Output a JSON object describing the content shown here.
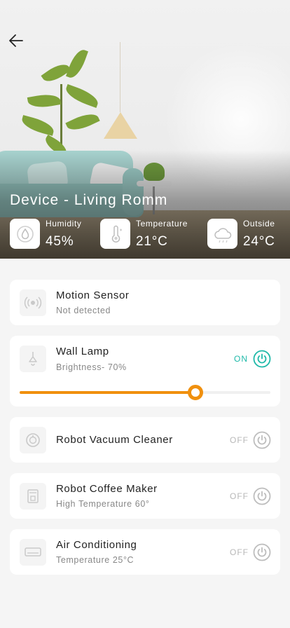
{
  "header": {
    "room_title": "Device - Living Romm"
  },
  "stats": [
    {
      "label": "Humidity",
      "value": "45%",
      "icon": "humidity-icon"
    },
    {
      "label": "Temperature",
      "value": "21°C",
      "icon": "thermometer-icon"
    },
    {
      "label": "Outside",
      "value": "24°C",
      "icon": "cloud-icon"
    }
  ],
  "devices": [
    {
      "name": "Motion Sensor",
      "sub": "Not detected",
      "icon": "motion-sensor-icon"
    },
    {
      "name": "Wall Lamp",
      "sub": "Brightness- 70%",
      "state": "ON",
      "icon": "lamp-icon",
      "brightness": 0.7
    },
    {
      "name": "Robot Vacuum Cleaner",
      "sub": "",
      "state": "OFF",
      "icon": "vacuum-icon"
    },
    {
      "name": "Robot Coffee Maker",
      "sub": "High Temperature 60°",
      "state": "OFF",
      "icon": "coffee-maker-icon"
    },
    {
      "name": "Air Conditioning",
      "sub": "Temperature 25°C",
      "state": "OFF",
      "icon": "air-conditioner-icon"
    }
  ],
  "colors": {
    "accent_on": "#1fb9a9",
    "slider": "#f0900e",
    "off": "#b8b8b8"
  }
}
